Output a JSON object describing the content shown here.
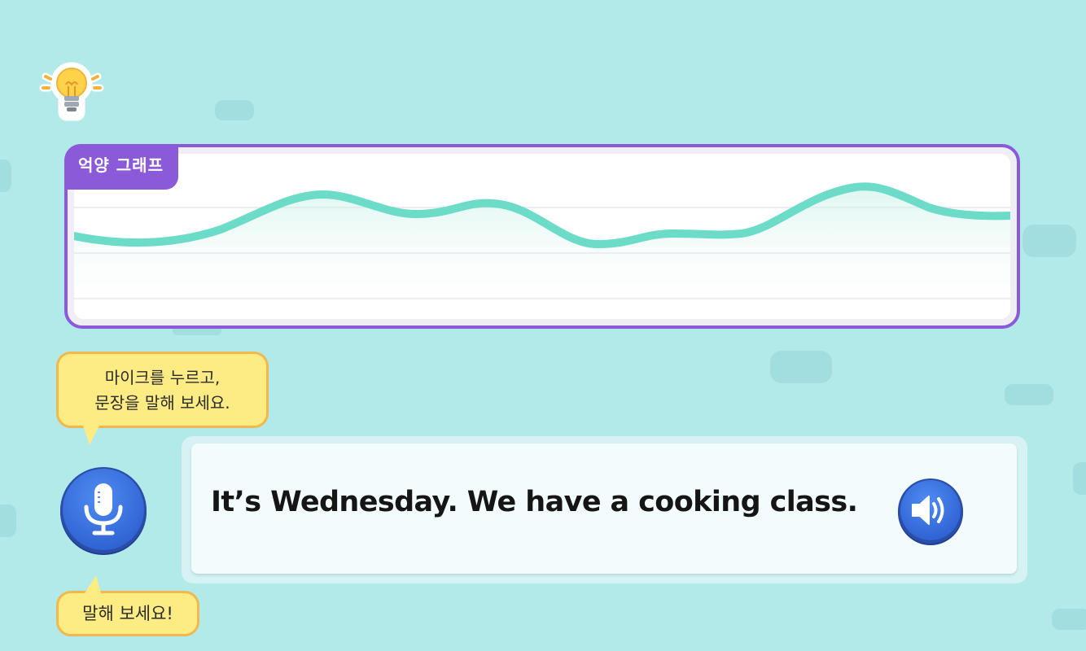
{
  "graph": {
    "tag_label": "억양 그래프"
  },
  "instruction": {
    "line1": "마이크를 누르고,",
    "line2": "문장을 말해 보세요."
  },
  "prompt_badge": "말해 보세요!",
  "sentence": {
    "text": "It’s Wednesday. We have a cooking class."
  },
  "icons": {
    "hint": "lightbulb-icon",
    "mic": "microphone-icon",
    "speaker": "speaker-icon"
  },
  "colors": {
    "background": "#b2eaea",
    "graph_border": "#8a5ad8",
    "wave": "#6cdcc8",
    "bubble_fill": "#fdeb84",
    "bubble_border": "#f1b94d",
    "button_blue": "#3a70dc"
  }
}
